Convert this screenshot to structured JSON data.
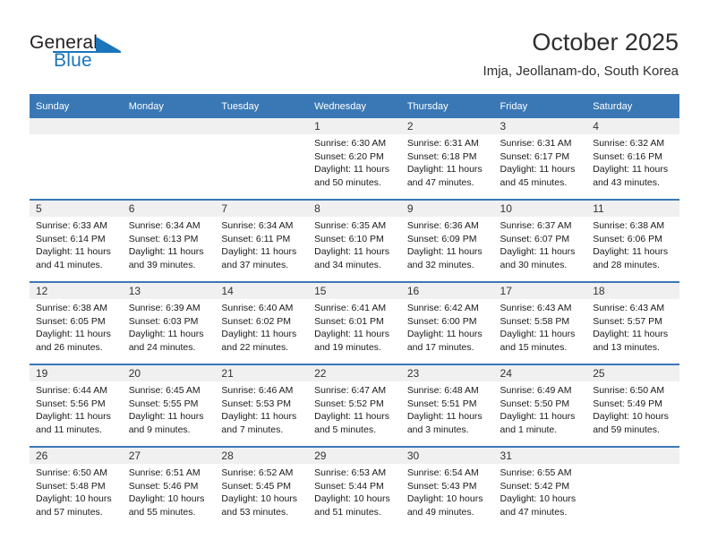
{
  "brand": {
    "name_part1": "General",
    "name_part2": "Blue",
    "accent_color": "#1b75bb"
  },
  "header": {
    "title": "October 2025",
    "subtitle": "Imja, Jeollanam-do, South Korea"
  },
  "theme": {
    "header_row_color": "#3a78b5",
    "daynum_band_color": "#f0f0f0"
  },
  "weekday_headers": [
    "Sunday",
    "Monday",
    "Tuesday",
    "Wednesday",
    "Thursday",
    "Friday",
    "Saturday"
  ],
  "weeks": [
    [
      {
        "day": "",
        "empty": true,
        "sunrise": "",
        "sunset": "",
        "daylight1": "",
        "daylight2": ""
      },
      {
        "day": "",
        "empty": true,
        "sunrise": "",
        "sunset": "",
        "daylight1": "",
        "daylight2": ""
      },
      {
        "day": "",
        "empty": true,
        "sunrise": "",
        "sunset": "",
        "daylight1": "",
        "daylight2": ""
      },
      {
        "day": "1",
        "sunrise": "Sunrise: 6:30 AM",
        "sunset": "Sunset: 6:20 PM",
        "daylight1": "Daylight: 11 hours",
        "daylight2": "and 50 minutes."
      },
      {
        "day": "2",
        "sunrise": "Sunrise: 6:31 AM",
        "sunset": "Sunset: 6:18 PM",
        "daylight1": "Daylight: 11 hours",
        "daylight2": "and 47 minutes."
      },
      {
        "day": "3",
        "sunrise": "Sunrise: 6:31 AM",
        "sunset": "Sunset: 6:17 PM",
        "daylight1": "Daylight: 11 hours",
        "daylight2": "and 45 minutes."
      },
      {
        "day": "4",
        "sunrise": "Sunrise: 6:32 AM",
        "sunset": "Sunset: 6:16 PM",
        "daylight1": "Daylight: 11 hours",
        "daylight2": "and 43 minutes."
      }
    ],
    [
      {
        "day": "5",
        "sunrise": "Sunrise: 6:33 AM",
        "sunset": "Sunset: 6:14 PM",
        "daylight1": "Daylight: 11 hours",
        "daylight2": "and 41 minutes."
      },
      {
        "day": "6",
        "sunrise": "Sunrise: 6:34 AM",
        "sunset": "Sunset: 6:13 PM",
        "daylight1": "Daylight: 11 hours",
        "daylight2": "and 39 minutes."
      },
      {
        "day": "7",
        "sunrise": "Sunrise: 6:34 AM",
        "sunset": "Sunset: 6:11 PM",
        "daylight1": "Daylight: 11 hours",
        "daylight2": "and 37 minutes."
      },
      {
        "day": "8",
        "sunrise": "Sunrise: 6:35 AM",
        "sunset": "Sunset: 6:10 PM",
        "daylight1": "Daylight: 11 hours",
        "daylight2": "and 34 minutes."
      },
      {
        "day": "9",
        "sunrise": "Sunrise: 6:36 AM",
        "sunset": "Sunset: 6:09 PM",
        "daylight1": "Daylight: 11 hours",
        "daylight2": "and 32 minutes."
      },
      {
        "day": "10",
        "sunrise": "Sunrise: 6:37 AM",
        "sunset": "Sunset: 6:07 PM",
        "daylight1": "Daylight: 11 hours",
        "daylight2": "and 30 minutes."
      },
      {
        "day": "11",
        "sunrise": "Sunrise: 6:38 AM",
        "sunset": "Sunset: 6:06 PM",
        "daylight1": "Daylight: 11 hours",
        "daylight2": "and 28 minutes."
      }
    ],
    [
      {
        "day": "12",
        "sunrise": "Sunrise: 6:38 AM",
        "sunset": "Sunset: 6:05 PM",
        "daylight1": "Daylight: 11 hours",
        "daylight2": "and 26 minutes."
      },
      {
        "day": "13",
        "sunrise": "Sunrise: 6:39 AM",
        "sunset": "Sunset: 6:03 PM",
        "daylight1": "Daylight: 11 hours",
        "daylight2": "and 24 minutes."
      },
      {
        "day": "14",
        "sunrise": "Sunrise: 6:40 AM",
        "sunset": "Sunset: 6:02 PM",
        "daylight1": "Daylight: 11 hours",
        "daylight2": "and 22 minutes."
      },
      {
        "day": "15",
        "sunrise": "Sunrise: 6:41 AM",
        "sunset": "Sunset: 6:01 PM",
        "daylight1": "Daylight: 11 hours",
        "daylight2": "and 19 minutes."
      },
      {
        "day": "16",
        "sunrise": "Sunrise: 6:42 AM",
        "sunset": "Sunset: 6:00 PM",
        "daylight1": "Daylight: 11 hours",
        "daylight2": "and 17 minutes."
      },
      {
        "day": "17",
        "sunrise": "Sunrise: 6:43 AM",
        "sunset": "Sunset: 5:58 PM",
        "daylight1": "Daylight: 11 hours",
        "daylight2": "and 15 minutes."
      },
      {
        "day": "18",
        "sunrise": "Sunrise: 6:43 AM",
        "sunset": "Sunset: 5:57 PM",
        "daylight1": "Daylight: 11 hours",
        "daylight2": "and 13 minutes."
      }
    ],
    [
      {
        "day": "19",
        "sunrise": "Sunrise: 6:44 AM",
        "sunset": "Sunset: 5:56 PM",
        "daylight1": "Daylight: 11 hours",
        "daylight2": "and 11 minutes."
      },
      {
        "day": "20",
        "sunrise": "Sunrise: 6:45 AM",
        "sunset": "Sunset: 5:55 PM",
        "daylight1": "Daylight: 11 hours",
        "daylight2": "and 9 minutes."
      },
      {
        "day": "21",
        "sunrise": "Sunrise: 6:46 AM",
        "sunset": "Sunset: 5:53 PM",
        "daylight1": "Daylight: 11 hours",
        "daylight2": "and 7 minutes."
      },
      {
        "day": "22",
        "sunrise": "Sunrise: 6:47 AM",
        "sunset": "Sunset: 5:52 PM",
        "daylight1": "Daylight: 11 hours",
        "daylight2": "and 5 minutes."
      },
      {
        "day": "23",
        "sunrise": "Sunrise: 6:48 AM",
        "sunset": "Sunset: 5:51 PM",
        "daylight1": "Daylight: 11 hours",
        "daylight2": "and 3 minutes."
      },
      {
        "day": "24",
        "sunrise": "Sunrise: 6:49 AM",
        "sunset": "Sunset: 5:50 PM",
        "daylight1": "Daylight: 11 hours",
        "daylight2": "and 1 minute."
      },
      {
        "day": "25",
        "sunrise": "Sunrise: 6:50 AM",
        "sunset": "Sunset: 5:49 PM",
        "daylight1": "Daylight: 10 hours",
        "daylight2": "and 59 minutes."
      }
    ],
    [
      {
        "day": "26",
        "sunrise": "Sunrise: 6:50 AM",
        "sunset": "Sunset: 5:48 PM",
        "daylight1": "Daylight: 10 hours",
        "daylight2": "and 57 minutes."
      },
      {
        "day": "27",
        "sunrise": "Sunrise: 6:51 AM",
        "sunset": "Sunset: 5:46 PM",
        "daylight1": "Daylight: 10 hours",
        "daylight2": "and 55 minutes."
      },
      {
        "day": "28",
        "sunrise": "Sunrise: 6:52 AM",
        "sunset": "Sunset: 5:45 PM",
        "daylight1": "Daylight: 10 hours",
        "daylight2": "and 53 minutes."
      },
      {
        "day": "29",
        "sunrise": "Sunrise: 6:53 AM",
        "sunset": "Sunset: 5:44 PM",
        "daylight1": "Daylight: 10 hours",
        "daylight2": "and 51 minutes."
      },
      {
        "day": "30",
        "sunrise": "Sunrise: 6:54 AM",
        "sunset": "Sunset: 5:43 PM",
        "daylight1": "Daylight: 10 hours",
        "daylight2": "and 49 minutes."
      },
      {
        "day": "31",
        "sunrise": "Sunrise: 6:55 AM",
        "sunset": "Sunset: 5:42 PM",
        "daylight1": "Daylight: 10 hours",
        "daylight2": "and 47 minutes."
      },
      {
        "day": "",
        "empty": true,
        "sunrise": "",
        "sunset": "",
        "daylight1": "",
        "daylight2": ""
      }
    ]
  ]
}
